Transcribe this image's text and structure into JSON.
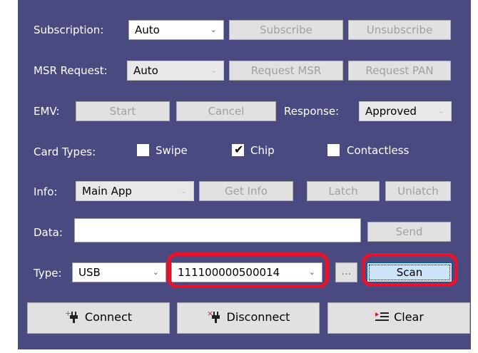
{
  "row_subscription": {
    "label": "Subscription:",
    "combo_value": "Auto",
    "subscribe": "Subscribe",
    "unsubscribe": "Unsubscribe"
  },
  "row_msr": {
    "label": "MSR Request:",
    "combo_value": "Auto",
    "request_msr": "Request MSR",
    "request_pan": "Request PAN"
  },
  "row_emv": {
    "label": "EMV:",
    "start": "Start",
    "cancel": "Cancel",
    "response_label": "Response:",
    "response_value": "Approved"
  },
  "row_cards": {
    "label": "Card Types:",
    "swipe": "Swipe",
    "chip": "Chip",
    "contactless": "Contactless",
    "swipe_checked": false,
    "chip_checked": true,
    "contactless_checked": false
  },
  "row_info": {
    "label": "Info:",
    "combo_value": "Main App",
    "get_info": "Get Info",
    "latch": "Latch",
    "unlatch": "Unlatch"
  },
  "row_data": {
    "label": "Data:",
    "value": "",
    "send": "Send"
  },
  "row_type": {
    "label": "Type:",
    "type_value": "USB",
    "device_value": "111100000500014",
    "browse": "...",
    "scan": "Scan"
  },
  "actions": {
    "connect": "Connect",
    "disconnect": "Disconnect",
    "clear": "Clear"
  },
  "colors": {
    "panel_bg": "#4a4a80",
    "highlight": "#e8132a",
    "scan_button_bg": "#cce4f7"
  }
}
